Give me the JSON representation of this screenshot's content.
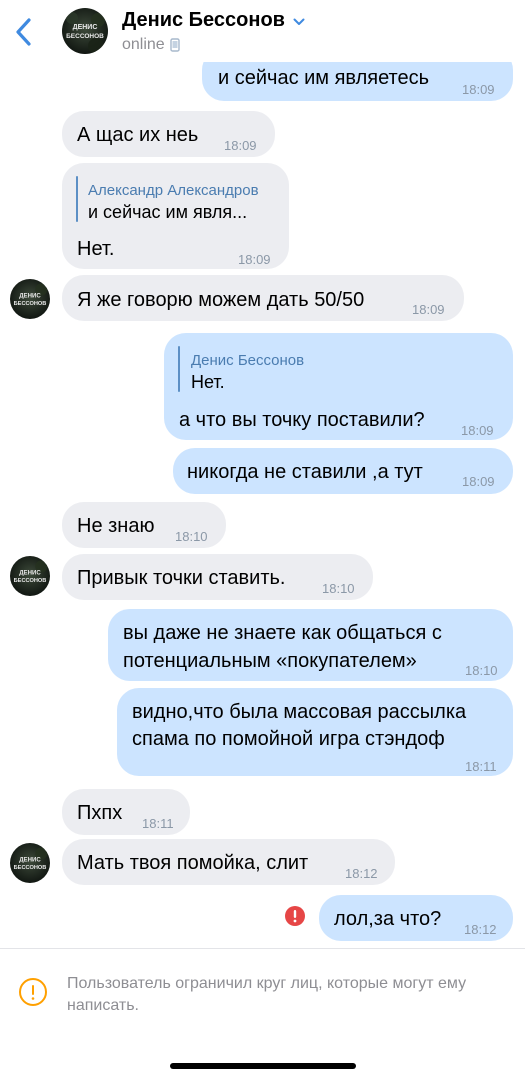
{
  "header": {
    "title": "Денис Бессонов",
    "status": "online",
    "avatar_text_top": "ДЕНИС",
    "avatar_text_bottom": "БЕССОНОВ"
  },
  "messages": [
    {
      "dir": "out",
      "text": "и сейчас им являетесь",
      "time": "18:09"
    },
    {
      "dir": "in",
      "text": "А щас их неь",
      "time": "18:09"
    },
    {
      "dir": "in",
      "reply_name": "Александр Александров",
      "reply_text": "и сейчас им явля...",
      "text": "Нет.",
      "time": "18:09"
    },
    {
      "dir": "in",
      "text": "Я же говорю можем дать 50/50",
      "time": "18:09"
    },
    {
      "dir": "out",
      "reply_name": "Денис Бессонов",
      "reply_text": "Нет.",
      "text": "а что вы точку поставили?",
      "time": "18:09"
    },
    {
      "dir": "out",
      "text": "никогда не ставили ,а тут",
      "time": "18:09"
    },
    {
      "dir": "in",
      "text": "Не знаю",
      "time": "18:10"
    },
    {
      "dir": "in",
      "text": "Привык точки ставить.",
      "time": "18:10"
    },
    {
      "dir": "out",
      "line1": "вы даже не знаете как общаться с",
      "line2": "потенциальным «покупателем»",
      "time": "18:10"
    },
    {
      "dir": "out",
      "line1": "видно,что была массовая рассылка",
      "line2": "спама по помойной игра стэндоф",
      "time": "18:11"
    },
    {
      "dir": "in",
      "text": "Пхпх",
      "time": "18:11"
    },
    {
      "dir": "in",
      "text": "Мать твоя помойка, слит",
      "time": "18:12"
    },
    {
      "dir": "out",
      "text": "лол,за что?",
      "time": "18:12",
      "failed": true
    }
  ],
  "footer": {
    "notice": "Пользователь ограничил круг лиц, которые могут ему написать."
  },
  "colors": {
    "incoming": "#ecedf1",
    "outgoing": "#cce4ff",
    "accent": "#3f8ae0",
    "error": "#e64646",
    "warning": "#ffa000"
  }
}
